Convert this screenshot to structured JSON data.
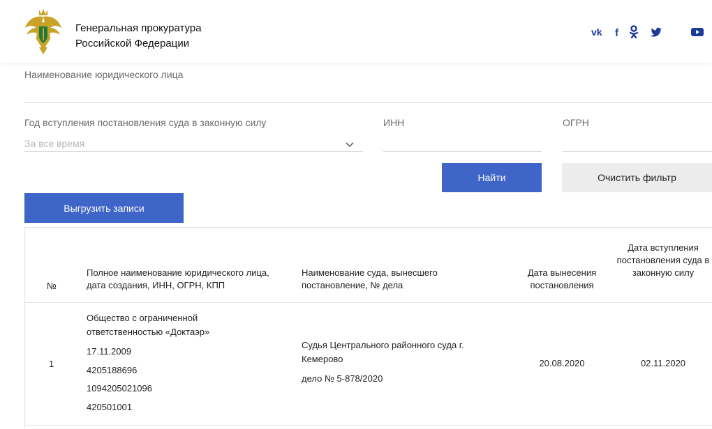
{
  "header": {
    "org_line1": "Генеральная прокуратура",
    "org_line2": "Российской Федерации",
    "social_icons": [
      "vk-icon",
      "facebook-icon",
      "odnoklassniki-icon",
      "twitter-icon",
      "youtube-icon"
    ]
  },
  "filters": {
    "legal_entity_label": "Наименование юридического лица",
    "legal_entity_value": "",
    "year_label": "Год вступления постановления суда в законную силу",
    "year_selected": "За все время",
    "inn_label": "ИНН",
    "inn_value": "",
    "ogrn_label": "ОГРН",
    "ogrn_value": ""
  },
  "buttons": {
    "find": "Найти",
    "clear": "Очистить фильтр",
    "export": "Выгрузить записи"
  },
  "table": {
    "headers": {
      "num": "№",
      "name": "Полное наименование юридического лица, дата создания, ИНН, ОГРН, КПП",
      "court": "Наименование суда, вынесшего постановление, № дела",
      "decision_date": "Дата вынесения постановления",
      "effective_date": "Дата вступления постановления суда в законную силу"
    },
    "rows": [
      {
        "num": "1",
        "name": "Общество с ограниченной ответственностью «Доктаэр»",
        "created": "17.11.2009",
        "inn": "4205188696",
        "ogrn": "1094205021096",
        "kpp": "420501001",
        "court": "Судья Центрального районного суда г. Кемерово",
        "case": "дело № 5-878/2020",
        "decision_date": "20.08.2020",
        "effective_date": "02.11.2020"
      }
    ]
  },
  "colors": {
    "primary": "#3f65c8",
    "social": "#1c3a9c",
    "emblem_gold": "#c9a227",
    "emblem_green": "#1f7a3a"
  }
}
